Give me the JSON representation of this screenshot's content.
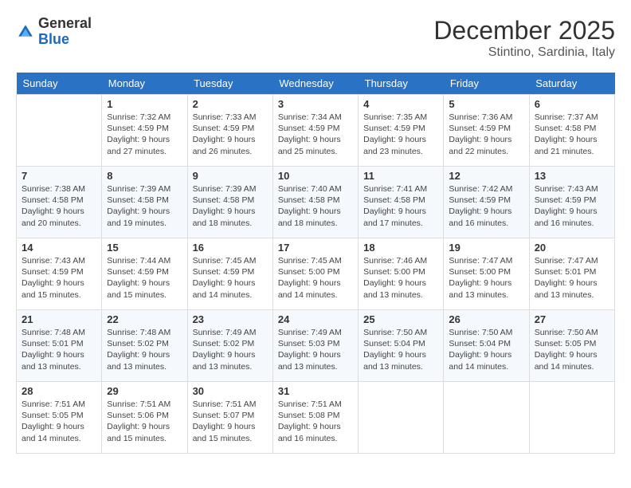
{
  "header": {
    "logo_general": "General",
    "logo_blue": "Blue",
    "month_year": "December 2025",
    "location": "Stintino, Sardinia, Italy"
  },
  "calendar": {
    "days_of_week": [
      "Sunday",
      "Monday",
      "Tuesday",
      "Wednesday",
      "Thursday",
      "Friday",
      "Saturday"
    ],
    "weeks": [
      [
        {
          "day": "",
          "sunrise": "",
          "sunset": "",
          "daylight": ""
        },
        {
          "day": "1",
          "sunrise": "Sunrise: 7:32 AM",
          "sunset": "Sunset: 4:59 PM",
          "daylight": "Daylight: 9 hours and 27 minutes."
        },
        {
          "day": "2",
          "sunrise": "Sunrise: 7:33 AM",
          "sunset": "Sunset: 4:59 PM",
          "daylight": "Daylight: 9 hours and 26 minutes."
        },
        {
          "day": "3",
          "sunrise": "Sunrise: 7:34 AM",
          "sunset": "Sunset: 4:59 PM",
          "daylight": "Daylight: 9 hours and 25 minutes."
        },
        {
          "day": "4",
          "sunrise": "Sunrise: 7:35 AM",
          "sunset": "Sunset: 4:59 PM",
          "daylight": "Daylight: 9 hours and 23 minutes."
        },
        {
          "day": "5",
          "sunrise": "Sunrise: 7:36 AM",
          "sunset": "Sunset: 4:59 PM",
          "daylight": "Daylight: 9 hours and 22 minutes."
        },
        {
          "day": "6",
          "sunrise": "Sunrise: 7:37 AM",
          "sunset": "Sunset: 4:58 PM",
          "daylight": "Daylight: 9 hours and 21 minutes."
        }
      ],
      [
        {
          "day": "7",
          "sunrise": "Sunrise: 7:38 AM",
          "sunset": "Sunset: 4:58 PM",
          "daylight": "Daylight: 9 hours and 20 minutes."
        },
        {
          "day": "8",
          "sunrise": "Sunrise: 7:39 AM",
          "sunset": "Sunset: 4:58 PM",
          "daylight": "Daylight: 9 hours and 19 minutes."
        },
        {
          "day": "9",
          "sunrise": "Sunrise: 7:39 AM",
          "sunset": "Sunset: 4:58 PM",
          "daylight": "Daylight: 9 hours and 18 minutes."
        },
        {
          "day": "10",
          "sunrise": "Sunrise: 7:40 AM",
          "sunset": "Sunset: 4:58 PM",
          "daylight": "Daylight: 9 hours and 18 minutes."
        },
        {
          "day": "11",
          "sunrise": "Sunrise: 7:41 AM",
          "sunset": "Sunset: 4:58 PM",
          "daylight": "Daylight: 9 hours and 17 minutes."
        },
        {
          "day": "12",
          "sunrise": "Sunrise: 7:42 AM",
          "sunset": "Sunset: 4:59 PM",
          "daylight": "Daylight: 9 hours and 16 minutes."
        },
        {
          "day": "13",
          "sunrise": "Sunrise: 7:43 AM",
          "sunset": "Sunset: 4:59 PM",
          "daylight": "Daylight: 9 hours and 16 minutes."
        }
      ],
      [
        {
          "day": "14",
          "sunrise": "Sunrise: 7:43 AM",
          "sunset": "Sunset: 4:59 PM",
          "daylight": "Daylight: 9 hours and 15 minutes."
        },
        {
          "day": "15",
          "sunrise": "Sunrise: 7:44 AM",
          "sunset": "Sunset: 4:59 PM",
          "daylight": "Daylight: 9 hours and 15 minutes."
        },
        {
          "day": "16",
          "sunrise": "Sunrise: 7:45 AM",
          "sunset": "Sunset: 4:59 PM",
          "daylight": "Daylight: 9 hours and 14 minutes."
        },
        {
          "day": "17",
          "sunrise": "Sunrise: 7:45 AM",
          "sunset": "Sunset: 5:00 PM",
          "daylight": "Daylight: 9 hours and 14 minutes."
        },
        {
          "day": "18",
          "sunrise": "Sunrise: 7:46 AM",
          "sunset": "Sunset: 5:00 PM",
          "daylight": "Daylight: 9 hours and 13 minutes."
        },
        {
          "day": "19",
          "sunrise": "Sunrise: 7:47 AM",
          "sunset": "Sunset: 5:00 PM",
          "daylight": "Daylight: 9 hours and 13 minutes."
        },
        {
          "day": "20",
          "sunrise": "Sunrise: 7:47 AM",
          "sunset": "Sunset: 5:01 PM",
          "daylight": "Daylight: 9 hours and 13 minutes."
        }
      ],
      [
        {
          "day": "21",
          "sunrise": "Sunrise: 7:48 AM",
          "sunset": "Sunset: 5:01 PM",
          "daylight": "Daylight: 9 hours and 13 minutes."
        },
        {
          "day": "22",
          "sunrise": "Sunrise: 7:48 AM",
          "sunset": "Sunset: 5:02 PM",
          "daylight": "Daylight: 9 hours and 13 minutes."
        },
        {
          "day": "23",
          "sunrise": "Sunrise: 7:49 AM",
          "sunset": "Sunset: 5:02 PM",
          "daylight": "Daylight: 9 hours and 13 minutes."
        },
        {
          "day": "24",
          "sunrise": "Sunrise: 7:49 AM",
          "sunset": "Sunset: 5:03 PM",
          "daylight": "Daylight: 9 hours and 13 minutes."
        },
        {
          "day": "25",
          "sunrise": "Sunrise: 7:50 AM",
          "sunset": "Sunset: 5:04 PM",
          "daylight": "Daylight: 9 hours and 13 minutes."
        },
        {
          "day": "26",
          "sunrise": "Sunrise: 7:50 AM",
          "sunset": "Sunset: 5:04 PM",
          "daylight": "Daylight: 9 hours and 14 minutes."
        },
        {
          "day": "27",
          "sunrise": "Sunrise: 7:50 AM",
          "sunset": "Sunset: 5:05 PM",
          "daylight": "Daylight: 9 hours and 14 minutes."
        }
      ],
      [
        {
          "day": "28",
          "sunrise": "Sunrise: 7:51 AM",
          "sunset": "Sunset: 5:05 PM",
          "daylight": "Daylight: 9 hours and 14 minutes."
        },
        {
          "day": "29",
          "sunrise": "Sunrise: 7:51 AM",
          "sunset": "Sunset: 5:06 PM",
          "daylight": "Daylight: 9 hours and 15 minutes."
        },
        {
          "day": "30",
          "sunrise": "Sunrise: 7:51 AM",
          "sunset": "Sunset: 5:07 PM",
          "daylight": "Daylight: 9 hours and 15 minutes."
        },
        {
          "day": "31",
          "sunrise": "Sunrise: 7:51 AM",
          "sunset": "Sunset: 5:08 PM",
          "daylight": "Daylight: 9 hours and 16 minutes."
        },
        {
          "day": "",
          "sunrise": "",
          "sunset": "",
          "daylight": ""
        },
        {
          "day": "",
          "sunrise": "",
          "sunset": "",
          "daylight": ""
        },
        {
          "day": "",
          "sunrise": "",
          "sunset": "",
          "daylight": ""
        }
      ]
    ]
  }
}
